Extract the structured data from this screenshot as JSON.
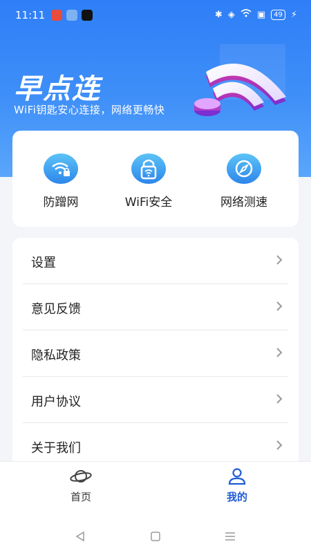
{
  "status_bar": {
    "time": "11:11",
    "battery": "49",
    "app_icons": [
      "#e94b3c",
      "#4a90e2",
      "#111111"
    ]
  },
  "hero": {
    "title": "早点连",
    "subtitle": "WiFi钥匙安心连接，网络更畅快"
  },
  "features": [
    {
      "label": "防蹭网",
      "icon": "wifi-lock-icon"
    },
    {
      "label": "WiFi安全",
      "icon": "wifi-padlock-icon"
    },
    {
      "label": "网络测速",
      "icon": "compass-speed-icon"
    }
  ],
  "menu": {
    "items": [
      {
        "label": "设置"
      },
      {
        "label": "意见反馈"
      },
      {
        "label": "隐私政策"
      },
      {
        "label": "用户协议"
      },
      {
        "label": "关于我们"
      }
    ]
  },
  "tabs": [
    {
      "label": "首页",
      "icon": "planet-icon",
      "active": false
    },
    {
      "label": "我的",
      "icon": "user-icon",
      "active": true
    }
  ],
  "colors": {
    "primary": "#2f7ef7",
    "active_tab": "#1f5bd6",
    "inactive_tab": "#333333",
    "chevron": "#9a9a9a"
  }
}
